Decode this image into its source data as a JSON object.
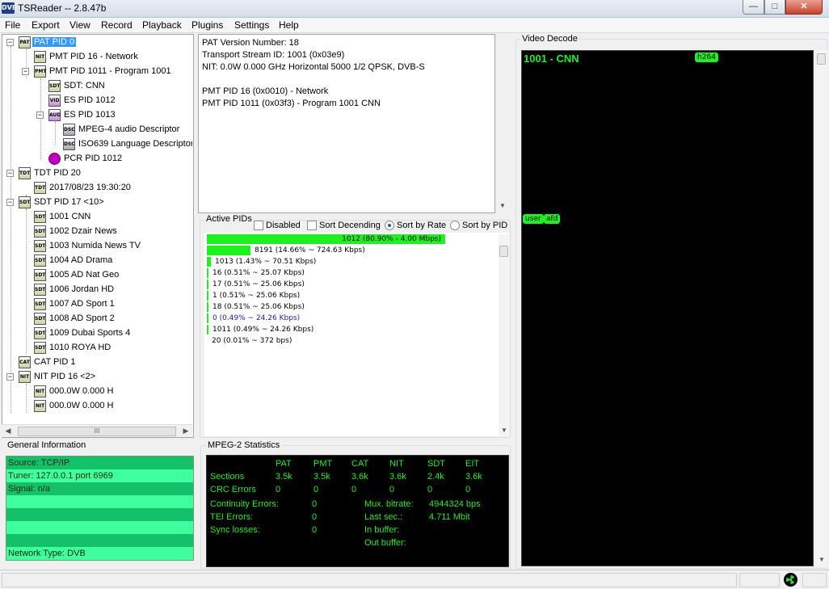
{
  "window": {
    "app_icon": "DVB",
    "title": "TSReader -- 2.8.47b",
    "minimize": "—",
    "maximize": "□",
    "close": "✕"
  },
  "menu": [
    "File",
    "Export",
    "View",
    "Record",
    "Playback",
    "Plugins",
    "Settings",
    "Help"
  ],
  "tree": {
    "items": [
      {
        "label": "PAT PID 0",
        "icon": "PAT",
        "selected": true
      },
      {
        "label": "PMT PID 16 - Network",
        "icon": "NIT"
      },
      {
        "label": "PMT PID 1011 - Program 1001",
        "icon": "PMT"
      },
      {
        "label": "SDT: CNN",
        "icon": "SDT"
      },
      {
        "label": "ES PID 1012",
        "icon": "VID"
      },
      {
        "label": "ES PID 1013",
        "icon": "AUD"
      },
      {
        "label": "MPEG-4 audio Descriptor",
        "icon": "DSC"
      },
      {
        "label": "ISO639 Language Descriptor",
        "icon": "DSC"
      },
      {
        "label": "PCR PID 1012",
        "icon": "PCR"
      },
      {
        "label": "TDT PID 20",
        "icon": "TDT"
      },
      {
        "label": "2017/08/23 19:30:20",
        "icon": "TDT"
      },
      {
        "label": "SDT PID 17 <10>",
        "icon": "SDT"
      },
      {
        "label": "1001 CNN",
        "icon": "SDT"
      },
      {
        "label": "1002 Dzair News",
        "icon": "SDT"
      },
      {
        "label": "1003 Numida News TV",
        "icon": "SDT"
      },
      {
        "label": "1004 AD Drama",
        "icon": "SDT"
      },
      {
        "label": "1005 AD Nat Geo",
        "icon": "SDT"
      },
      {
        "label": "1006 Jordan HD",
        "icon": "SDT"
      },
      {
        "label": "1007 AD Sport 1",
        "icon": "SDT"
      },
      {
        "label": "1008 AD Sport 2",
        "icon": "SDT"
      },
      {
        "label": "1009 Dubai Sports 4",
        "icon": "SDT"
      },
      {
        "label": "1010 ROYA HD",
        "icon": "SDT"
      },
      {
        "label": "CAT PID 1",
        "icon": "CAT"
      },
      {
        "label": "NIT PID 16 <2>",
        "icon": "NIT"
      },
      {
        "label": "000.0W 0.000 H",
        "icon": "NIT"
      },
      {
        "label": "000.0W 0.000 H",
        "icon": "NIT"
      }
    ],
    "expand_minus": "−",
    "scroll_thumb": "III",
    "scroll_left": "◀",
    "scroll_right": "▶"
  },
  "pat_info": {
    "lines": [
      "PAT Version Number: 18",
      "Transport Stream ID: 1001 (0x03e9)",
      "NIT: 0.0W 0.000 GHz Horizontal  5000 1/2 QPSK, DVB-S",
      "",
      "PMT PID 16 (0x0010) - Network",
      "PMT PID 1011 (0x03f3) - Program 1001 CNN"
    ]
  },
  "active_pids": {
    "label": "Active PIDs",
    "disabled": "Disabled",
    "sort_desc": "Sort Decending",
    "sort_rate": "Sort by Rate",
    "sort_pid": "Sort by PID",
    "sort_selected": "rate",
    "rows": [
      {
        "text": "1012 (80.90% - 4.00 Mbps)",
        "share": 0.809,
        "color": "#000"
      },
      {
        "text": "8191 (14.66% ~ 724.63 Kbps)",
        "share": 0.1466,
        "color": "#000"
      },
      {
        "text": "1013 (1.43% ~ 70.51 Kbps)",
        "share": 0.0143,
        "color": "#000"
      },
      {
        "text": "16 (0.51% ~ 25.07 Kbps)",
        "share": 0.0051,
        "color": "#000"
      },
      {
        "text": "17 (0.51% ~ 25.06 Kbps)",
        "share": 0.0051,
        "color": "#000"
      },
      {
        "text": "1 (0.51% ~ 25.06 Kbps)",
        "share": 0.0051,
        "color": "#000"
      },
      {
        "text": "18 (0.51% ~ 25.06 Kbps)",
        "share": 0.0051,
        "color": "#000"
      },
      {
        "text": "0 (0.49% ~ 24.26 Kbps)",
        "share": 0.0049,
        "color": "#1a1aa8"
      },
      {
        "text": "1011 (0.49% ~ 24.26 Kbps)",
        "share": 0.0049,
        "color": "#000"
      },
      {
        "text": "20 (0.01% ~ 372 bps)",
        "share": 0.0001,
        "color": "#000"
      }
    ]
  },
  "video_decode": {
    "label": "Video Decode",
    "channel": "1001 - CNN",
    "codec_tag": "h264",
    "tags": [
      "user",
      "afd"
    ]
  },
  "general_info": {
    "label": "General Information",
    "rows": [
      "Source: TCP/IP",
      "Tuner: 127.0.0.1 port 6969",
      "Signal: n/a",
      "",
      "",
      "",
      "",
      "Network Type: DVB"
    ]
  },
  "mpeg2_stats": {
    "label": "MPEG-2 Statistics",
    "columns": [
      "PAT",
      "PMT",
      "CAT",
      "NIT",
      "SDT",
      "EIT"
    ],
    "sections_label": "Sections",
    "sections": [
      "3.5k",
      "3.5k",
      "3.6k",
      "3.6k",
      "2.4k",
      "3.6k"
    ],
    "crc_label": "CRC Errors",
    "crc": [
      "0",
      "0",
      "0",
      "0",
      "0",
      "0"
    ],
    "continuity_label": "Continuity Errors:",
    "continuity": "0",
    "tei_label": "TEI Errors:",
    "tei": "0",
    "sync_label": "Sync losses:",
    "sync": "0",
    "mux_label": "Mux. bitrate:",
    "mux": "4944324 bps",
    "last_label": "Last sec.:",
    "last": "4.711 Mbit",
    "inbuf_label": "In buffer:",
    "outbuf_label": "Out buffer:"
  },
  "colors": {
    "accent_green": "#1cf21c",
    "selection_blue": "#3399ff"
  }
}
